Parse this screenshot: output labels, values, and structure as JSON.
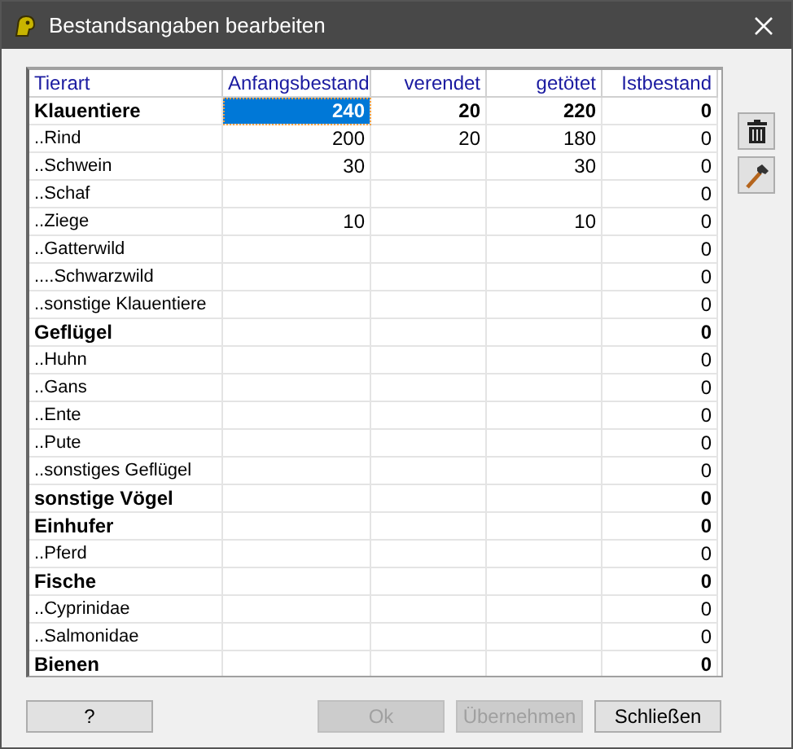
{
  "window": {
    "title": "Bestandsangaben bearbeiten"
  },
  "table": {
    "columns": [
      "Tierart",
      "Anfangsbestand",
      "verendet",
      "getötet",
      "Istbestand"
    ],
    "rows": [
      {
        "kind": "group",
        "cells": [
          {
            "text": "Klauentiere",
            "selected": false
          },
          {
            "text": "240",
            "selected": true
          },
          {
            "text": "20",
            "selected": false
          },
          {
            "text": "220",
            "selected": false
          },
          {
            "text": "0",
            "selected": false
          }
        ]
      },
      {
        "kind": "item",
        "cells": [
          {
            "text": "..Rind",
            "selected": false
          },
          {
            "text": "200",
            "selected": false
          },
          {
            "text": "20",
            "selected": false
          },
          {
            "text": "180",
            "selected": false
          },
          {
            "text": "0",
            "selected": false
          }
        ]
      },
      {
        "kind": "item",
        "cells": [
          {
            "text": "..Schwein",
            "selected": false
          },
          {
            "text": "30",
            "selected": false
          },
          {
            "selected": false
          },
          {
            "text": "30",
            "selected": false
          },
          {
            "text": "0",
            "selected": false
          }
        ]
      },
      {
        "kind": "item",
        "cells": [
          {
            "text": "..Schaf",
            "selected": false
          },
          {
            "selected": false
          },
          {
            "selected": false
          },
          {
            "selected": false
          },
          {
            "text": "0",
            "selected": false
          }
        ]
      },
      {
        "kind": "item",
        "cells": [
          {
            "text": "..Ziege",
            "selected": false
          },
          {
            "text": "10",
            "selected": false
          },
          {
            "selected": false
          },
          {
            "text": "10",
            "selected": false
          },
          {
            "text": "0",
            "selected": false
          }
        ]
      },
      {
        "kind": "item",
        "cells": [
          {
            "text": "..Gatterwild",
            "selected": false
          },
          {
            "selected": false
          },
          {
            "selected": false
          },
          {
            "selected": false
          },
          {
            "text": "0",
            "selected": false
          }
        ]
      },
      {
        "kind": "item",
        "cells": [
          {
            "text": "....Schwarzwild",
            "selected": false
          },
          {
            "selected": false
          },
          {
            "selected": false
          },
          {
            "selected": false
          },
          {
            "text": "0",
            "selected": false
          }
        ]
      },
      {
        "kind": "item",
        "cells": [
          {
            "text": "..sonstige Klauentiere",
            "selected": false
          },
          {
            "selected": false
          },
          {
            "selected": false
          },
          {
            "selected": false
          },
          {
            "text": "0",
            "selected": false
          }
        ]
      },
      {
        "kind": "group",
        "cells": [
          {
            "text": "Geflügel",
            "selected": false
          },
          {
            "selected": false
          },
          {
            "selected": false
          },
          {
            "selected": false
          },
          {
            "text": "0",
            "selected": false
          }
        ]
      },
      {
        "kind": "item",
        "cells": [
          {
            "text": "..Huhn",
            "selected": false
          },
          {
            "selected": false
          },
          {
            "selected": false
          },
          {
            "selected": false
          },
          {
            "text": "0",
            "selected": false
          }
        ]
      },
      {
        "kind": "item",
        "cells": [
          {
            "text": "..Gans",
            "selected": false
          },
          {
            "selected": false
          },
          {
            "selected": false
          },
          {
            "selected": false
          },
          {
            "text": "0",
            "selected": false
          }
        ]
      },
      {
        "kind": "item",
        "cells": [
          {
            "text": "..Ente",
            "selected": false
          },
          {
            "selected": false
          },
          {
            "selected": false
          },
          {
            "selected": false
          },
          {
            "text": "0",
            "selected": false
          }
        ]
      },
      {
        "kind": "item",
        "cells": [
          {
            "text": "..Pute",
            "selected": false
          },
          {
            "selected": false
          },
          {
            "selected": false
          },
          {
            "selected": false
          },
          {
            "text": "0",
            "selected": false
          }
        ]
      },
      {
        "kind": "item",
        "cells": [
          {
            "text": "..sonstiges Geflügel",
            "selected": false
          },
          {
            "selected": false
          },
          {
            "selected": false
          },
          {
            "selected": false
          },
          {
            "text": "0",
            "selected": false
          }
        ]
      },
      {
        "kind": "group",
        "cells": [
          {
            "text": "sonstige Vögel",
            "selected": false
          },
          {
            "selected": false
          },
          {
            "selected": false
          },
          {
            "selected": false
          },
          {
            "text": "0",
            "selected": false
          }
        ]
      },
      {
        "kind": "group",
        "cells": [
          {
            "text": "Einhufer",
            "selected": false
          },
          {
            "selected": false
          },
          {
            "selected": false
          },
          {
            "selected": false
          },
          {
            "text": "0",
            "selected": false
          }
        ]
      },
      {
        "kind": "item",
        "cells": [
          {
            "text": "..Pferd",
            "selected": false
          },
          {
            "selected": false
          },
          {
            "selected": false
          },
          {
            "selected": false
          },
          {
            "text": "0",
            "selected": false
          }
        ]
      },
      {
        "kind": "group",
        "cells": [
          {
            "text": "Fische",
            "selected": false
          },
          {
            "selected": false
          },
          {
            "selected": false
          },
          {
            "selected": false
          },
          {
            "text": "0",
            "selected": false
          }
        ]
      },
      {
        "kind": "item",
        "cells": [
          {
            "text": "..Cyprinidae",
            "selected": false
          },
          {
            "selected": false
          },
          {
            "selected": false
          },
          {
            "selected": false
          },
          {
            "text": "0",
            "selected": false
          }
        ]
      },
      {
        "kind": "item",
        "cells": [
          {
            "text": "..Salmonidae",
            "selected": false
          },
          {
            "selected": false
          },
          {
            "selected": false
          },
          {
            "selected": false
          },
          {
            "text": "0",
            "selected": false
          }
        ]
      },
      {
        "kind": "group",
        "cells": [
          {
            "text": "Bienen",
            "selected": false
          },
          {
            "selected": false
          },
          {
            "selected": false
          },
          {
            "selected": false
          },
          {
            "text": "0",
            "selected": false
          }
        ]
      }
    ]
  },
  "buttons": [
    {
      "label": "?",
      "disabled": false
    },
    {
      "label": "Ok",
      "disabled": true
    },
    {
      "label": "Übernehmen",
      "disabled": true
    },
    {
      "label": "Schließen",
      "disabled": false
    }
  ]
}
